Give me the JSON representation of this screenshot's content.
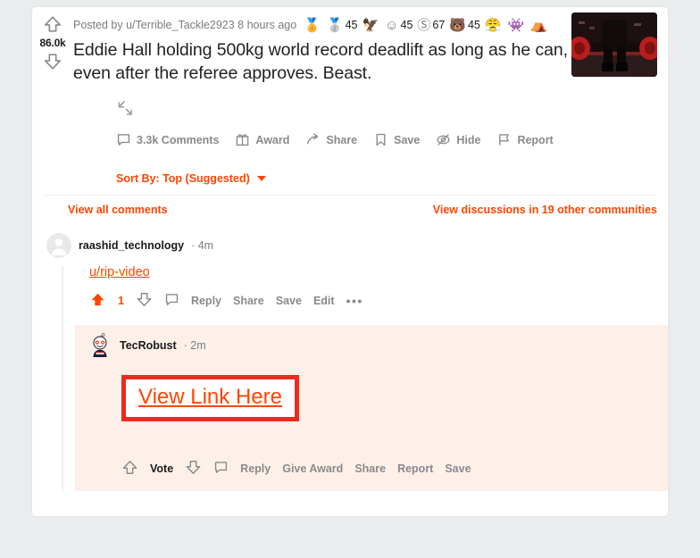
{
  "post": {
    "vote_score": "86.0k",
    "upvote_icon": "upvote-arrow-icon",
    "downvote_icon": "downvote-arrow-icon",
    "byline_prefix": "Posted by",
    "author": "u/Terrible_Tackle2923",
    "age": "8 hours ago",
    "awards": [
      {
        "icon": "gold-award-icon",
        "glyph": "🏅",
        "count": ""
      },
      {
        "icon": "silver-award-icon",
        "glyph": "🥈",
        "count": "45"
      },
      {
        "icon": "ternion-award-icon",
        "glyph": "🦆",
        "count": ""
      },
      {
        "icon": "wholesome-award-icon",
        "glyph": "☺",
        "count": "45"
      },
      {
        "icon": "silver-s-award-icon",
        "glyph": "Ⓢ",
        "count": "67"
      },
      {
        "icon": "bear-award-icon",
        "glyph": "🐻",
        "count": "45"
      },
      {
        "icon": "table-flip-award-icon",
        "glyph": "😤",
        "count": ""
      },
      {
        "icon": "snoo-award-icon",
        "glyph": "👾",
        "count": ""
      },
      {
        "icon": "tent-award-icon",
        "glyph": "⛺",
        "count": ""
      }
    ],
    "title": "Eddie Hall holding 500kg world record deadlift as long as he can, even after the referee approves. Beast.",
    "thumbnail_alt": "strongman-deadlift-thumbnail",
    "expand_icon": "expand-collapse-icon",
    "actions": [
      {
        "icon": "comment-bubble-icon",
        "label": "3.3k Comments"
      },
      {
        "icon": "gift-award-icon",
        "label": "Award"
      },
      {
        "icon": "share-arrow-icon",
        "label": "Share"
      },
      {
        "icon": "bookmark-save-icon",
        "label": "Save"
      },
      {
        "icon": "eye-slash-hide-icon",
        "label": "Hide"
      },
      {
        "icon": "flag-report-icon",
        "label": "Report"
      }
    ]
  },
  "sort": {
    "label": "Sort By: Top (Suggested)",
    "caret_icon": "chevron-down-icon"
  },
  "links": {
    "view_all_comments": "View all comments",
    "other_communities": "View discussions in 19 other communities"
  },
  "comments": [
    {
      "avatar_icon": "default-snoo-avatar",
      "author": "raashid_technology",
      "age": "· 4m",
      "body_link": "u/rip-video",
      "score": "1",
      "upvote_icon": "upvote-arrow-filled-icon",
      "downvote_icon": "downvote-arrow-icon",
      "comment_icon": "comment-bubble-icon",
      "actions": [
        "Reply",
        "Share",
        "Save",
        "Edit"
      ],
      "more_icon": "more-options-icon",
      "more_glyph": "•••"
    }
  ],
  "nested_comment": {
    "avatar_icon": "tecrobust-snoo-avatar",
    "author": "TecRobust",
    "age": "· 2m",
    "highlighted_link": "View Link Here",
    "highlight_box_color": "#ee2a20",
    "vote_up_icon": "upvote-arrow-icon",
    "vote_label": "Vote",
    "vote_down_icon": "downvote-arrow-icon",
    "comment_icon": "comment-bubble-icon",
    "actions": [
      "Reply",
      "Give Award",
      "Share",
      "Report",
      "Save"
    ]
  },
  "colors": {
    "accent": "#ff4500",
    "page_bg": "#ebecee",
    "highlight_bg": "#fdf0e9",
    "muted": "#878a8c"
  }
}
